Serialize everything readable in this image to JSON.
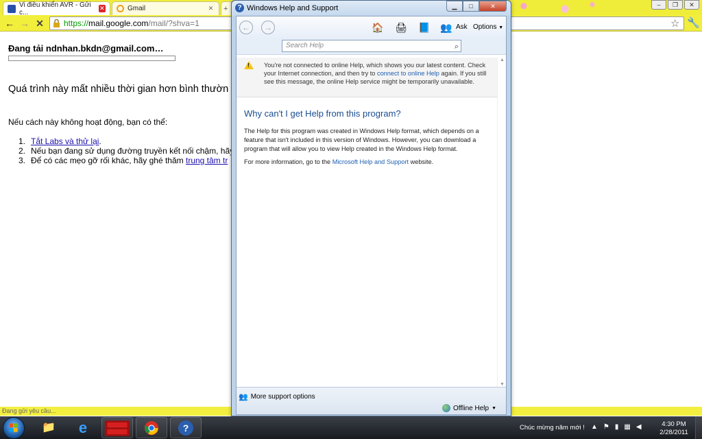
{
  "browser": {
    "tabs": [
      {
        "label": "Vi điều khiển AVR - Gửi c...",
        "active": true
      },
      {
        "label": "Gmail",
        "active": false
      }
    ],
    "url_scheme": "https://",
    "url_host": "mail.google.com",
    "url_path": "/mail/?shva=1",
    "status_text": "Đang gửi yêu cầu..."
  },
  "page": {
    "loading_title": "Đang tải ndnhan.bkdn@gmail.com…",
    "slow_message": "Quá trình này mất nhiều thời gian hơn bình thườn",
    "if_not_working": "Nếu cách này không hoạt động, bạn có thể:",
    "steps": [
      {
        "num": "1.",
        "text": "",
        "link": "Tắt Labs và thử lại",
        "suffix": "."
      },
      {
        "num": "2.",
        "text": "Nếu bạn đang sử dụng đường truyền kết nối chậm, hãy",
        "link": "",
        "suffix": ""
      },
      {
        "num": "3.",
        "text": "Để có các mẹo gỡ rối khác, hãy ghé thăm ",
        "link": "trung tâm tr",
        "suffix": ""
      }
    ]
  },
  "help": {
    "window_title": "Windows Help and Support",
    "ask_label": "Ask",
    "options_label": "Options",
    "search_placeholder": "Search Help",
    "warning_pre": "You're not connected to online Help, which shows you our latest content. Check your Internet connection, and then try to ",
    "warning_link": "connect to online Help",
    "warning_post": " again. If you still see this message, the online Help service might be temporarily unavailable.",
    "heading": "Why can't I get Help from this program?",
    "body1": "The Help for this program was created in Windows Help format, which depends on a feature that isn't included in this version of Windows. However, you can download a program that will allow you to view Help created in the Windows Help format.",
    "body2_pre": "For more information, go to the ",
    "body2_link": "Microsoft Help and Support",
    "body2_post": " website.",
    "more_support": "More support options",
    "offline_help": "Offline Help"
  },
  "taskbar": {
    "notification_text": "Chúc mừng năm mới !",
    "time": "4:30 PM",
    "date": "2/28/2011"
  }
}
